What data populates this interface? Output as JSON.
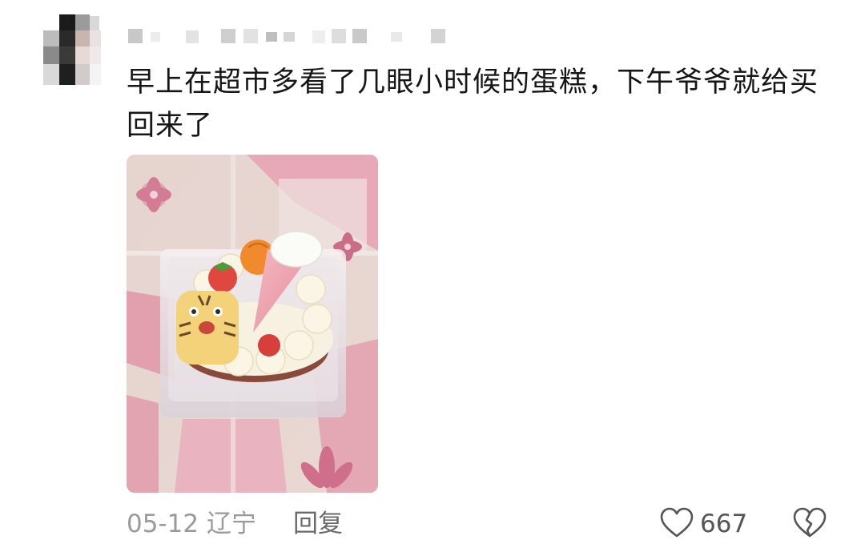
{
  "comment": {
    "text": "早上在超市多看了几眼小时候的蛋糕，下午爷爷就给买回来了",
    "date": "05-12",
    "region": "辽宁",
    "reply_label": "回复",
    "like_count": "667"
  },
  "icons": {
    "like": "heart-outline-icon",
    "dislike": "broken-heart-outline-icon"
  },
  "colors": {
    "meta_text": "#9a9a9a",
    "icon_stroke": "#555555"
  }
}
